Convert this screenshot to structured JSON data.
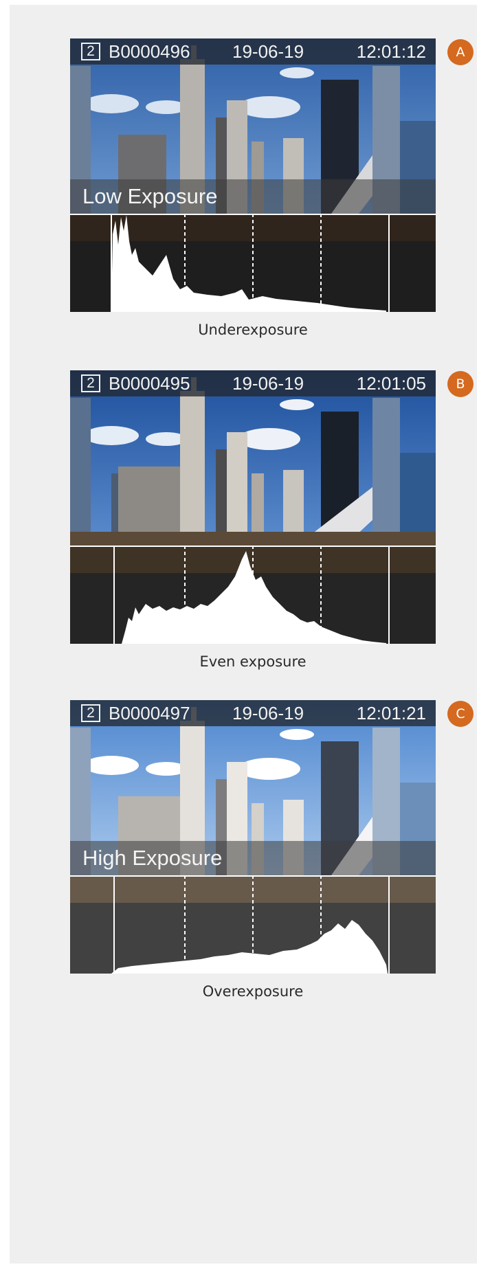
{
  "panels": [
    {
      "badge": "A",
      "frame_number": "2",
      "file_id": "B0000496",
      "date": "19-06-19",
      "time": "12:01:12",
      "overlay_label": "Low Exposure",
      "caption": "Underexposure"
    },
    {
      "badge": "B",
      "frame_number": "2",
      "file_id": "B0000495",
      "date": "19-06-19",
      "time": "12:01:05",
      "overlay_label": "",
      "caption": "Even exposure"
    },
    {
      "badge": "C",
      "frame_number": "2",
      "file_id": "B0000497",
      "date": "19-06-19",
      "time": "12:01:21",
      "overlay_label": "High Exposure",
      "caption": "Overexposure"
    }
  ],
  "colors": {
    "badge": "#d4691f",
    "panel_background": "#efefef",
    "histogram": "#ffffff"
  },
  "icons": [
    "city-photo",
    "histogram-graph",
    "frame-number-box"
  ]
}
